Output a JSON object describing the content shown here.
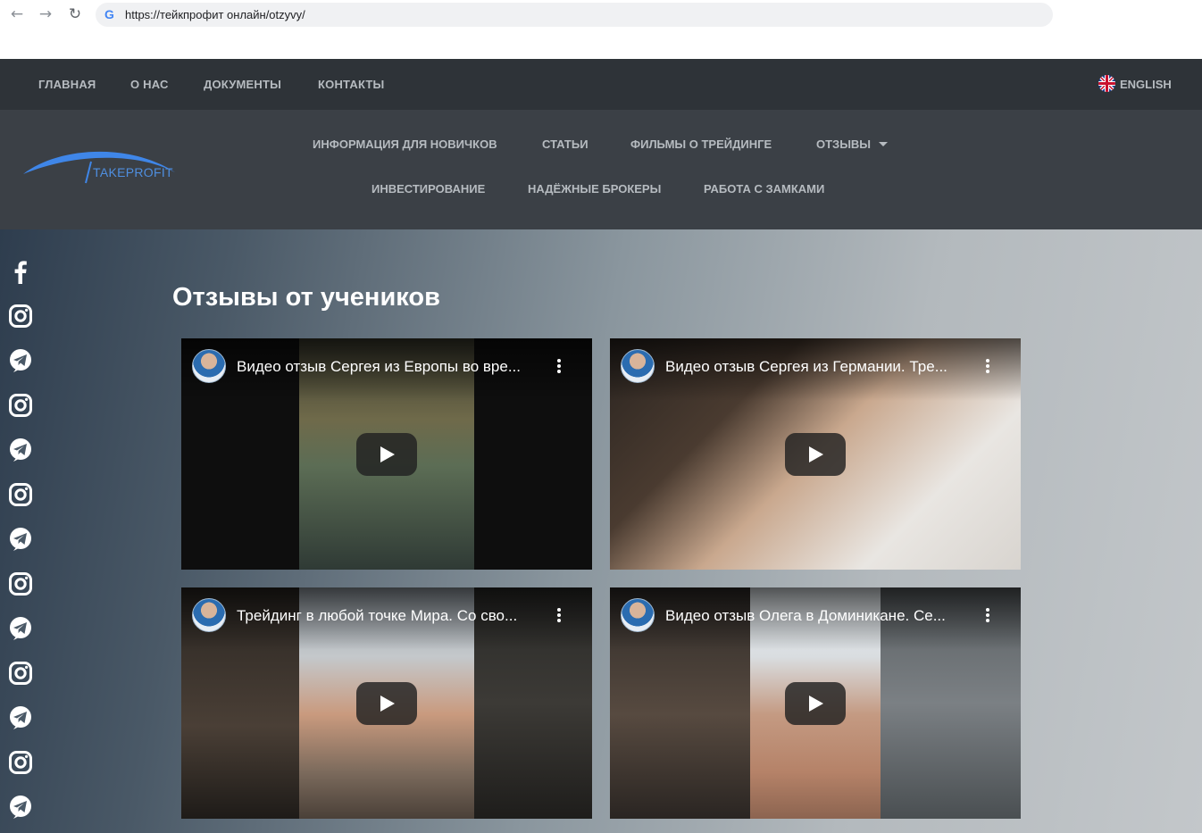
{
  "browser": {
    "url": "https://тейкпрофит онлайн/otzyvy/"
  },
  "top_nav": {
    "items": [
      "ГЛАВНАЯ",
      "О НАС",
      "ДОКУМЕНТЫ",
      "КОНТАКТЫ"
    ],
    "language": "ENGLISH"
  },
  "header": {
    "logo_text": "TAKEPROFIT",
    "menu": [
      "ИНФОРМАЦИЯ ДЛЯ НОВИЧКОВ",
      "СТАТЬИ",
      "ФИЛЬМЫ О ТРЕЙДИНГЕ",
      "ОТЗЫВЫ",
      "ИНВЕСТИРОВАНИЕ",
      "НАДЁЖНЫЕ БРОКЕРЫ",
      "РАБОТА С ЗАМКАМИ"
    ]
  },
  "page": {
    "title": "Отзывы от учеников"
  },
  "social": [
    "facebook-icon",
    "instagram-icon",
    "telegram-icon",
    "instagram-icon",
    "telegram-icon",
    "instagram-icon",
    "telegram-icon",
    "instagram-icon",
    "telegram-icon",
    "instagram-icon",
    "telegram-icon",
    "instagram-icon",
    "telegram-icon"
  ],
  "videos": [
    {
      "title": "Видео отзыв Сергея из Европы во вре..."
    },
    {
      "title": "Видео отзыв Сергея из Германии. Тре..."
    },
    {
      "title": "Трейдинг в любой точке Мира. Со сво..."
    },
    {
      "title": "Видео отзыв Олега в Доминикане. Се..."
    }
  ],
  "colors": {
    "nav_bg": "#2e3338",
    "header_bg": "#3b4046",
    "nav_text": "#b6bbc0",
    "logo_blue": "#4f8fe0"
  }
}
